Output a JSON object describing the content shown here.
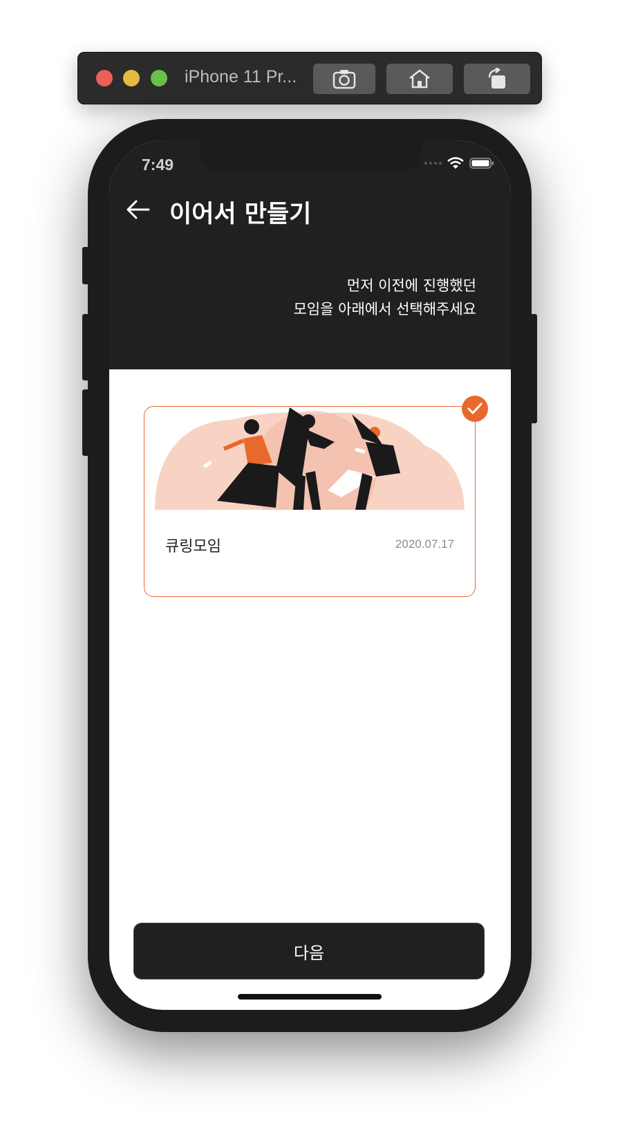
{
  "simulator": {
    "title": "iPhone 11 Pr...",
    "buttons": [
      "screenshot-icon",
      "home-icon",
      "rotate-icon"
    ]
  },
  "status_bar": {
    "time": "7:49"
  },
  "header": {
    "title": "이어서 만들기",
    "subtitle_line1": "먼저 이전에 진행했던",
    "subtitle_line2": "모임을 아래에서 선택해주세요"
  },
  "meetings": [
    {
      "name": "큐링모임",
      "date": "2020.07.17",
      "selected": true
    }
  ],
  "footer": {
    "next_label": "다음"
  },
  "colors": {
    "accent": "#e8692d",
    "dark": "#202020",
    "illustration_bg": "#f8d3c4"
  }
}
